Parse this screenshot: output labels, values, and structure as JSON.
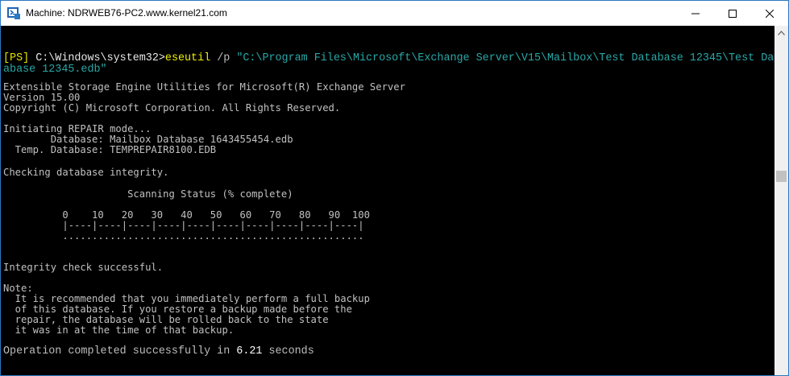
{
  "window": {
    "title": "Machine: NDRWEB76-PC2.www.kernel21.com",
    "icon": "powershell-session-icon"
  },
  "controls": {
    "minimize_icon": "minimize-icon",
    "maximize_icon": "maximize-icon",
    "close_icon": "close-icon"
  },
  "prompt": {
    "tag": "[PS]",
    "path": " C:\\Windows\\system32>",
    "command": "eseutil",
    "switch": " /p ",
    "arg_line1": "\"C:\\Program Files\\Microsoft\\Exchange Server\\V15\\Mailbox\\Test Database 12345\\Test Dat",
    "arg_line2": "abase 12345.edb\""
  },
  "output": [
    "Extensible Storage Engine Utilities for Microsoft(R) Exchange Server",
    "Version 15.00",
    "Copyright (C) Microsoft Corporation. All Rights Reserved.",
    "",
    "Initiating REPAIR mode...",
    "        Database: Mailbox Database 1643455454.edb",
    "  Temp. Database: TEMPREPAIR8100.EDB",
    "",
    "Checking database integrity.",
    "",
    "                     Scanning Status (% complete)",
    "",
    "          0    10   20   30   40   50   60   70   80   90  100",
    "          |----|----|----|----|----|----|----|----|----|----|",
    "          ...................................................",
    "",
    "",
    "Integrity check successful.",
    "",
    "Note:",
    "  It is recommended that you immediately perform a full backup",
    "  of this database. If you restore a backup made before the",
    "  repair, the database will be rolled back to the state",
    "  it was in at the time of that backup."
  ],
  "completion": {
    "prefix": "Operation completed successfully in ",
    "seconds": "6.21",
    "suffix": " seconds"
  },
  "colors": {
    "background": "#000000",
    "text": "#c0c0c0",
    "prompt": "#e6e600",
    "string": "#2aa7a7"
  }
}
